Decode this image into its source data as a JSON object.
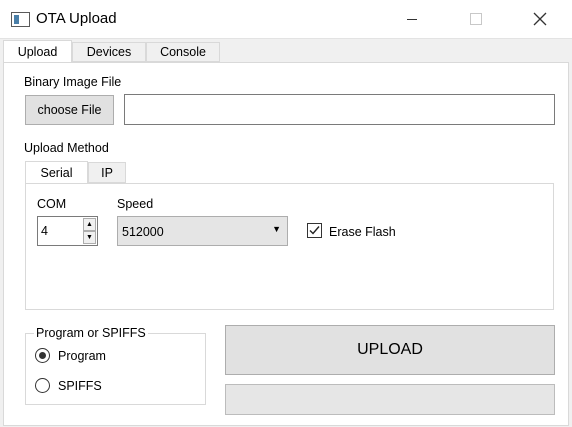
{
  "window": {
    "title": "OTA Upload"
  },
  "tabs": [
    {
      "label": "Upload",
      "active": true
    },
    {
      "label": "Devices",
      "active": false
    },
    {
      "label": "Console",
      "active": false
    }
  ],
  "upload": {
    "binary_label": "Binary Image File",
    "choose_file_label": "choose File",
    "file_path_value": "",
    "upload_method_label": "Upload Method",
    "method_tabs": [
      {
        "label": "Serial",
        "active": true
      },
      {
        "label": "IP",
        "active": false
      }
    ],
    "serial": {
      "com_label": "COM",
      "com_value": "4",
      "speed_label": "Speed",
      "speed_value": "512000",
      "erase_flash_label": "Erase Flash",
      "erase_flash_checked": true
    },
    "target_group": {
      "title": "Program or SPIFFS",
      "options": [
        {
          "label": "Program",
          "selected": true
        },
        {
          "label": "SPIFFS",
          "selected": false
        }
      ]
    },
    "upload_button_label": "UPLOAD",
    "progress": 0
  },
  "icons": {
    "check": "checkmark-icon",
    "close": "close-icon"
  }
}
